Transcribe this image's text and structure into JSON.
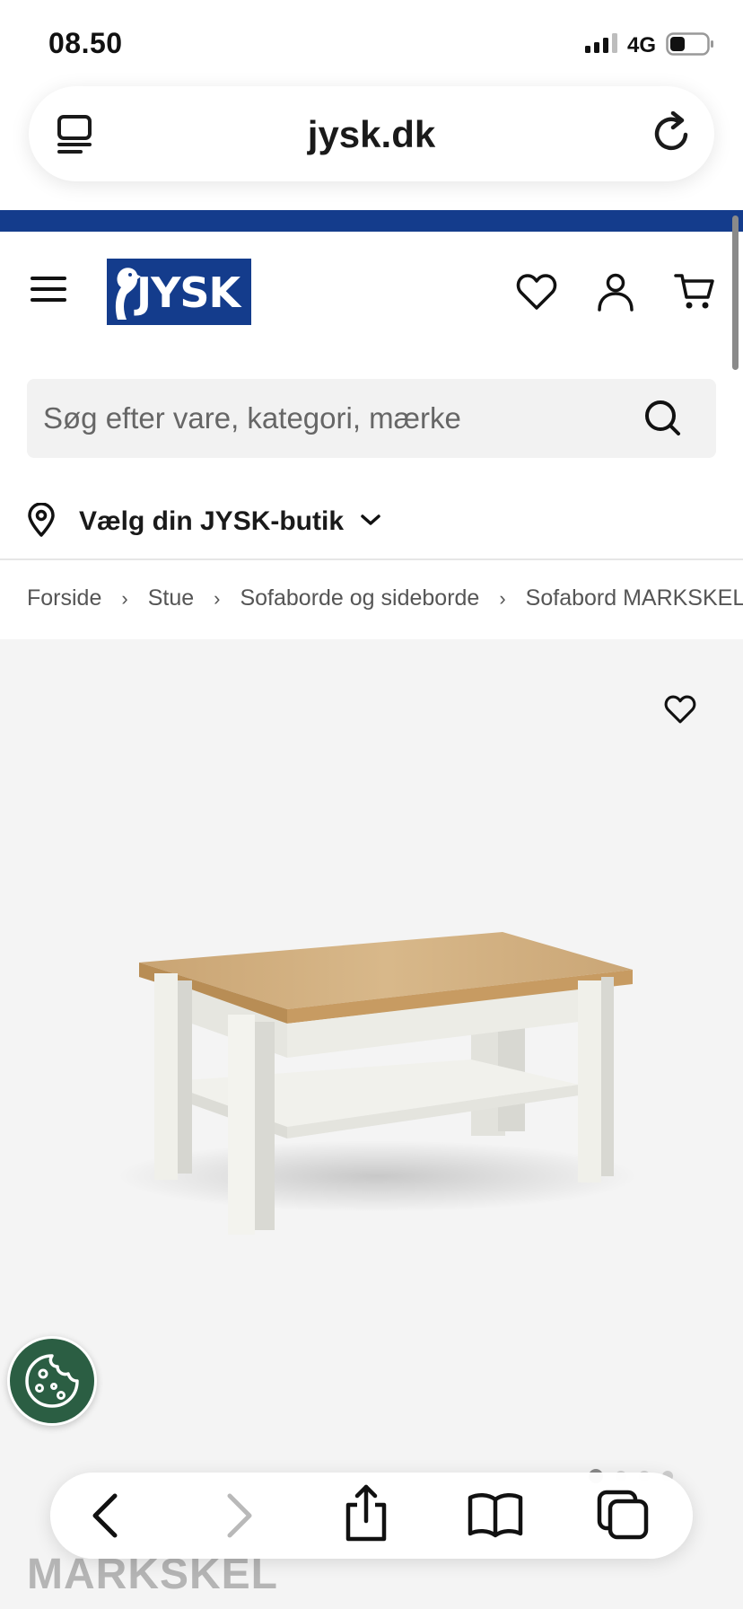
{
  "status_bar": {
    "time": "08.50",
    "network": "4G"
  },
  "browser": {
    "url": "jysk.dk"
  },
  "header": {
    "logo_text": "JYSK"
  },
  "search": {
    "placeholder": "Søg efter vare, kategori, mærke"
  },
  "store": {
    "label": "Vælg din JYSK-butik"
  },
  "breadcrumb": {
    "items": [
      "Forside",
      "Stue",
      "Sofaborde og sideborde",
      "Sofabord MARKSKEL"
    ]
  },
  "product": {
    "title": "MARKSKEL",
    "image_count": 4,
    "active_image": 1
  },
  "colors": {
    "brand_blue": "#143c8c",
    "cookie_green": "#2b5e43"
  },
  "icons": {
    "tab_manager": "tab-manager-icon",
    "reload": "reload-icon",
    "menu": "hamburger-menu-icon",
    "wishlist": "heart-icon",
    "account": "user-icon",
    "cart": "cart-icon",
    "search": "search-icon",
    "pin": "location-pin-icon",
    "chevron": "chevron-down-icon",
    "cookie": "cookie-icon",
    "back": "back-icon",
    "forward": "forward-icon",
    "share": "share-icon",
    "bookmarks": "book-icon",
    "tabs": "tabs-icon"
  }
}
